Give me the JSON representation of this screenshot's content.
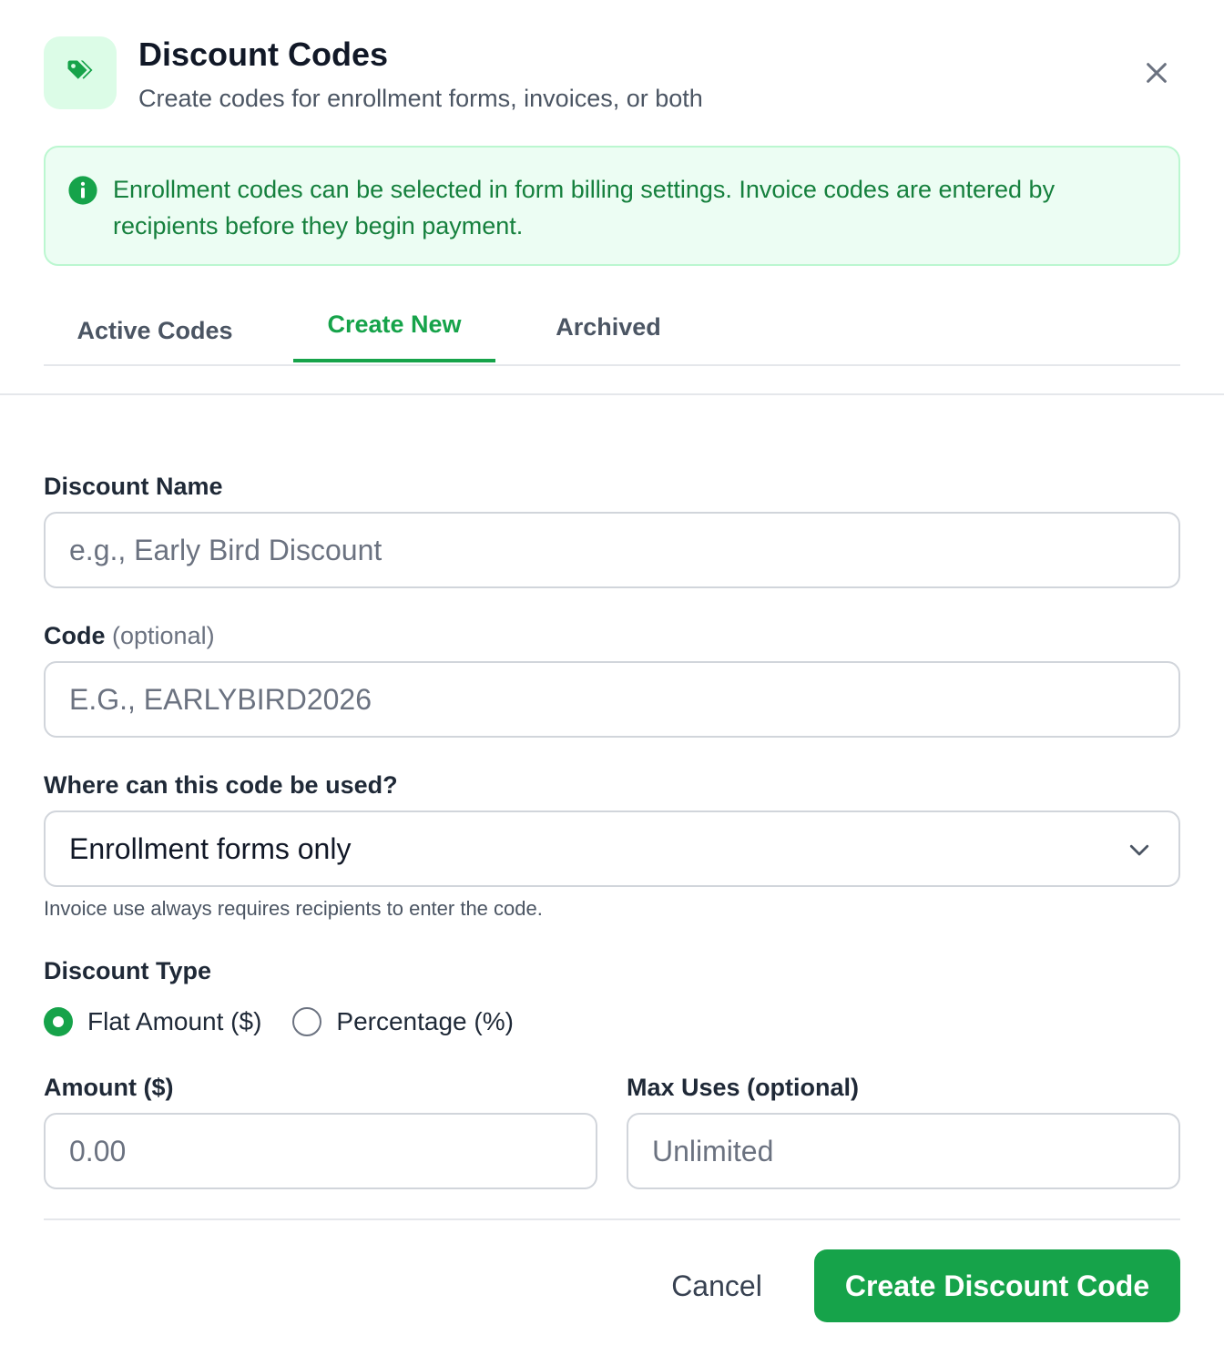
{
  "header": {
    "title": "Discount Codes",
    "subtitle": "Create codes for enrollment forms, invoices, or both",
    "icon": "tag-icon",
    "close_icon": "close-icon"
  },
  "info": {
    "icon": "info-icon",
    "text": "Enrollment codes can be selected in form billing settings. Invoice codes are entered by recipients before they begin payment."
  },
  "tabs": [
    {
      "label": "Active Codes",
      "active": false
    },
    {
      "label": "Create New",
      "active": true
    },
    {
      "label": "Archived",
      "active": false
    }
  ],
  "form": {
    "discount_name": {
      "label": "Discount Name",
      "placeholder": "e.g., Early Bird Discount",
      "value": ""
    },
    "code": {
      "label": "Code",
      "optional": "(optional)",
      "placeholder": "E.G., EARLYBIRD2026",
      "value": ""
    },
    "usage": {
      "label": "Where can this code be used?",
      "selected": "Enrollment forms only",
      "helper": "Invoice use always requires recipients to enter the code."
    },
    "discount_type": {
      "label": "Discount Type",
      "options": [
        {
          "label": "Flat Amount ($)",
          "checked": true
        },
        {
          "label": "Percentage (%)",
          "checked": false
        }
      ]
    },
    "amount": {
      "label": "Amount ($)",
      "placeholder": "0.00",
      "value": ""
    },
    "max_uses": {
      "label": "Max Uses (optional)",
      "placeholder": "Unlimited",
      "value": ""
    }
  },
  "footer": {
    "cancel_label": "Cancel",
    "create_label": "Create Discount Code"
  },
  "colors": {
    "accent": "#16a34a",
    "info_bg": "#ecfdf3",
    "info_border": "#bbf7d0",
    "info_text": "#15803d",
    "icon_bg": "#dcfce7"
  }
}
